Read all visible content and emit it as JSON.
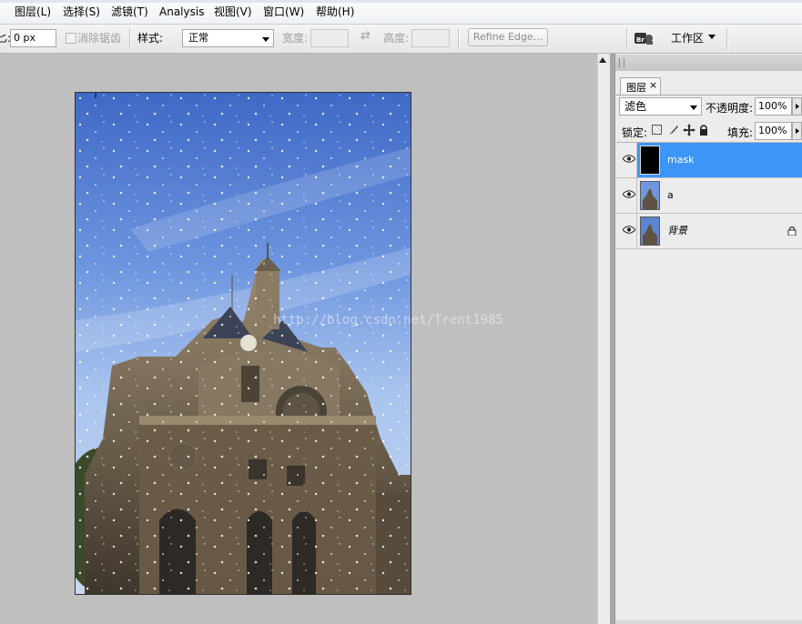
{
  "menu": [
    "图层(L)",
    "选择(S)",
    "滤镜(T)",
    "Analysis",
    "视图(V)",
    "窗口(W)",
    "帮助(H)"
  ],
  "options": {
    "feather_label": "匕:",
    "feather_value": "0 px",
    "antialias_label": "消除锯齿",
    "style_label": "样式:",
    "style_value": "正常",
    "width_label": "宽度:",
    "height_label": "高度:",
    "refine_button": "Refine Edge...",
    "workspace_label": "工作区"
  },
  "canvas": {
    "watermark": "http://blog.csdn.net/Trent1985"
  },
  "layers_panel": {
    "tab_label": "图层",
    "blend_mode": "滤色",
    "opacity_label": "不透明度:",
    "opacity_value": "100%",
    "lock_label": "锁定:",
    "fill_label": "填充:",
    "fill_value": "100%",
    "layers": [
      {
        "name": "mask",
        "selected": true,
        "visible": true
      },
      {
        "name": "a",
        "selected": false,
        "visible": true
      },
      {
        "name": "背景",
        "selected": false,
        "visible": true,
        "locked": true
      }
    ]
  },
  "colors": {
    "selection": "#3d95f7",
    "panel_bg": "#ececec",
    "canvas_bg": "#bfbfbf"
  }
}
